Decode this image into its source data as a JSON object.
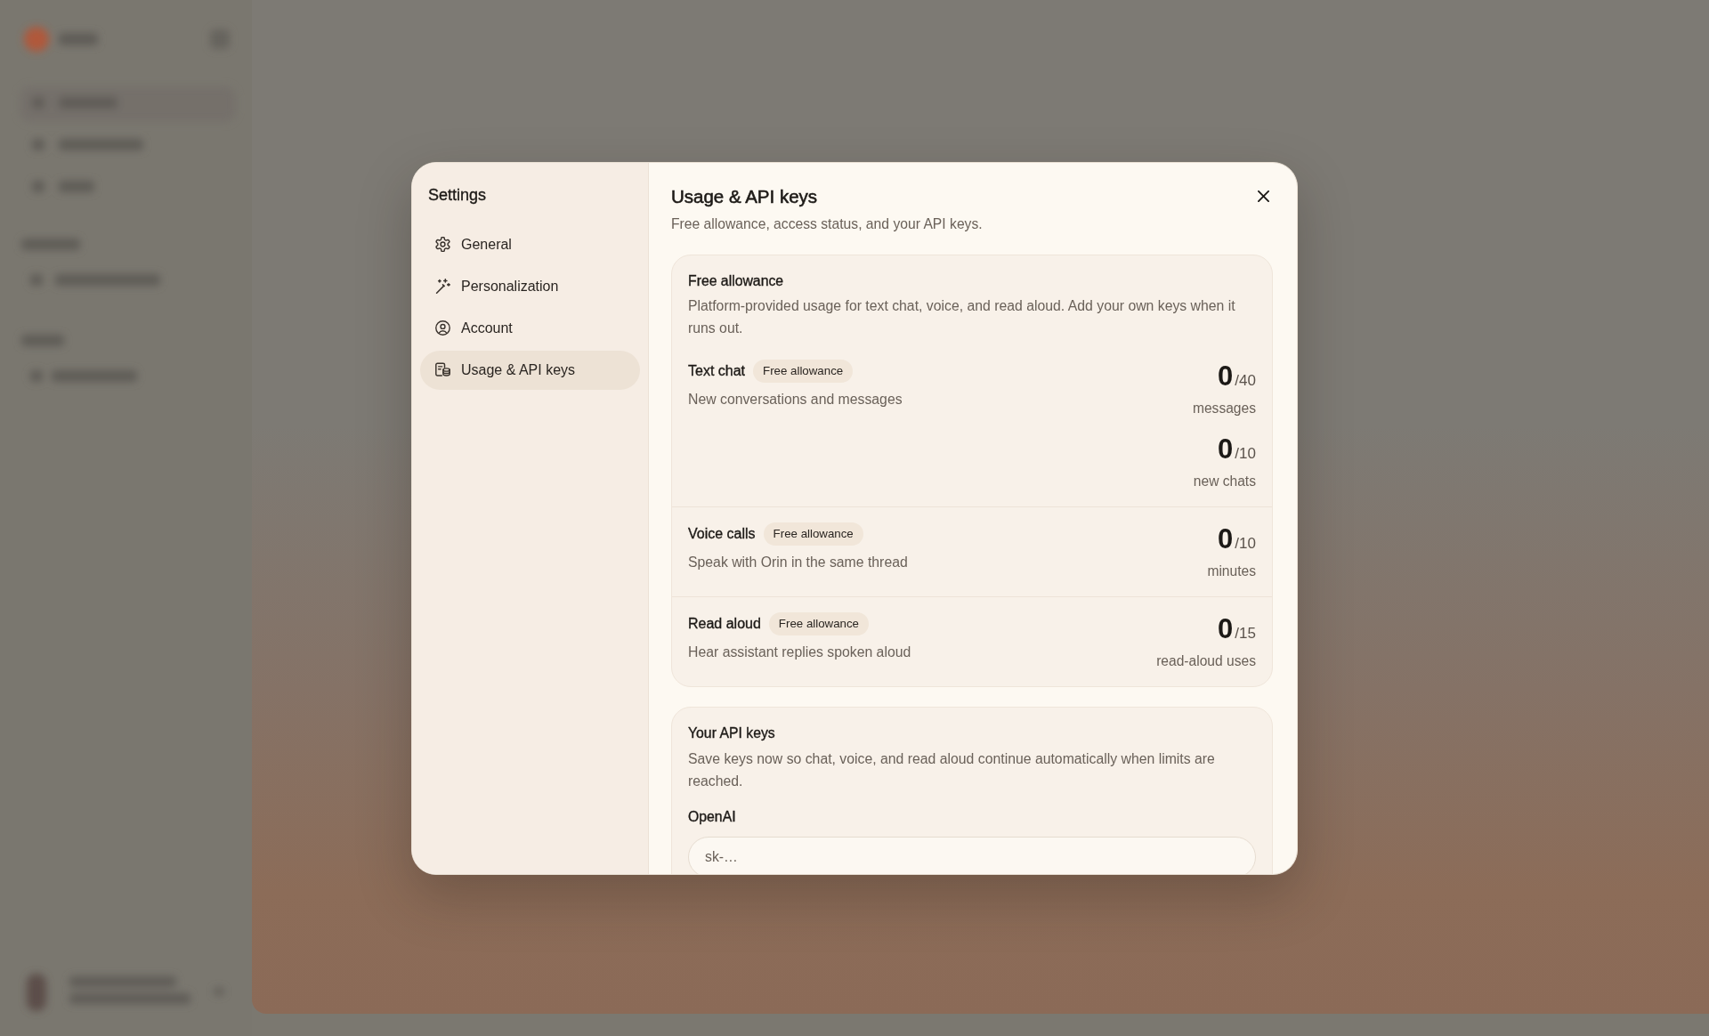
{
  "settings_nav": {
    "title": "Settings",
    "items": [
      {
        "label": "General",
        "selected": false
      },
      {
        "label": "Personalization",
        "selected": false
      },
      {
        "label": "Account",
        "selected": false
      },
      {
        "label": "Usage & API keys",
        "selected": true
      }
    ]
  },
  "content": {
    "title": "Usage & API keys",
    "subtitle": "Free allowance, access status, and your API keys.",
    "free_allowance": {
      "title": "Free allowance",
      "description": "Platform-provided usage for text chat, voice, and read aloud. Add your own keys when it runs out.",
      "rows": [
        {
          "title": "Text chat",
          "badge": "Free allowance",
          "description": "New conversations and messages",
          "counts": [
            {
              "value": "0",
              "total": "/40",
              "unit": "messages"
            },
            {
              "value": "0",
              "total": "/10",
              "unit": "new chats"
            }
          ]
        },
        {
          "title": "Voice calls",
          "badge": "Free allowance",
          "description": "Speak with Orin in the same thread",
          "counts": [
            {
              "value": "0",
              "total": "/10",
              "unit": "minutes"
            }
          ]
        },
        {
          "title": "Read aloud",
          "badge": "Free allowance",
          "description": "Hear assistant replies spoken aloud",
          "counts": [
            {
              "value": "0",
              "total": "/15",
              "unit": "read-aloud uses"
            }
          ]
        }
      ]
    },
    "api_keys": {
      "title": "Your API keys",
      "description": "Save keys now so chat, voice, and read aloud continue automatically when limits are reached.",
      "fields": [
        {
          "label": "OpenAI",
          "placeholder": "sk-…"
        }
      ]
    }
  }
}
